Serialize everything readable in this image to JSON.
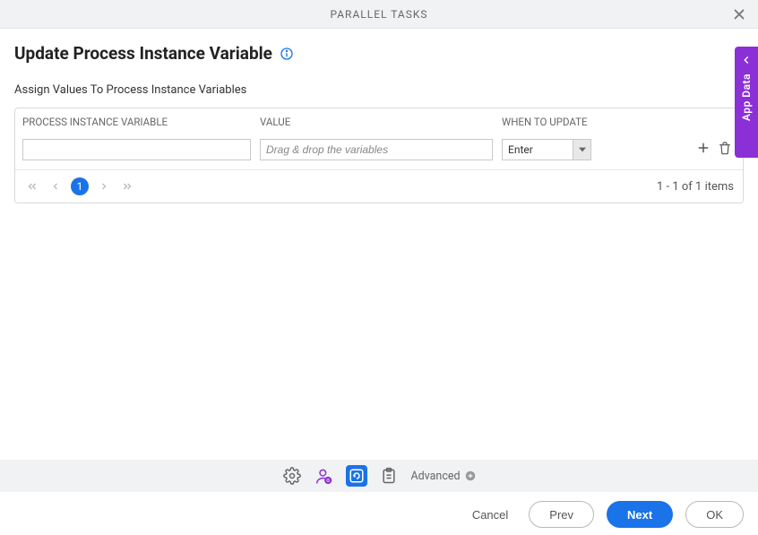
{
  "header": {
    "title": "PARALLEL TASKS"
  },
  "page": {
    "title": "Update Process Instance Variable",
    "section_label": "Assign Values To Process Instance Variables"
  },
  "grid": {
    "headers": {
      "variable": "PROCESS INSTANCE VARIABLE",
      "value": "VALUE",
      "when": "WHEN TO UPDATE"
    },
    "rows": [
      {
        "variable": "",
        "value_placeholder": "Drag & drop the variables",
        "when": "Enter"
      }
    ],
    "pager": {
      "current": "1",
      "info": "1 - 1 of 1 items"
    }
  },
  "side_tab": {
    "label": "App Data"
  },
  "toolbar": {
    "advanced_label": "Advanced"
  },
  "footer": {
    "cancel": "Cancel",
    "prev": "Prev",
    "next": "Next",
    "ok": "OK"
  }
}
